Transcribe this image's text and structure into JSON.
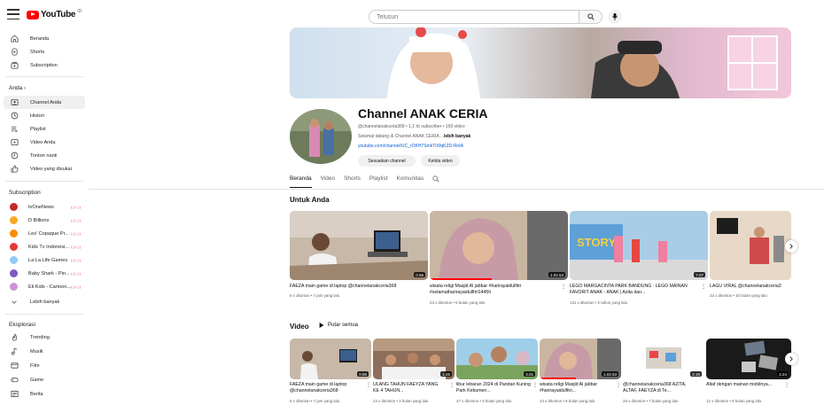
{
  "header": {
    "logo_text": "YouTube",
    "logo_sup": "ID",
    "search_placeholder": "Telusuri"
  },
  "sidebar": {
    "main": [
      {
        "label": "Beranda",
        "icon": "home-icon"
      },
      {
        "label": "Shorts",
        "icon": "shorts-icon"
      },
      {
        "label": "Subscription",
        "icon": "subscriptions-icon"
      }
    ],
    "you_heading": "Anda",
    "you": [
      {
        "label": "Channel Anda",
        "icon": "channel-icon",
        "active": true
      },
      {
        "label": "Histori",
        "icon": "history-icon"
      },
      {
        "label": "Playlist",
        "icon": "playlist-icon"
      },
      {
        "label": "Video Anda",
        "icon": "your-videos-icon"
      },
      {
        "label": "Tonton nanti",
        "icon": "watch-later-icon"
      },
      {
        "label": "Video yang disukai",
        "icon": "liked-icon"
      }
    ],
    "subs_heading": "Subscription",
    "subs": [
      {
        "label": "tvOneNews",
        "color": "#c62828"
      },
      {
        "label": "D Billions",
        "color": "#f9a825"
      },
      {
        "label": "Les' Copaque Pr...",
        "color": "#fb8c00"
      },
      {
        "label": "Kids Tv Indonesi...",
        "color": "#e53935"
      },
      {
        "label": "La La Life Games",
        "color": "#90caf9"
      },
      {
        "label": "Baby Shark - Pin...",
        "color": "#7e57c2"
      },
      {
        "label": "Eli Kids - Cartoon...",
        "color": "#ce93d8"
      }
    ],
    "more_label": "Lebih banyak",
    "explore_heading": "Eksplorasi",
    "explore": [
      {
        "label": "Trending",
        "icon": "trending-icon"
      },
      {
        "label": "Musik",
        "icon": "music-icon"
      },
      {
        "label": "Film",
        "icon": "film-icon"
      },
      {
        "label": "Game",
        "icon": "game-icon"
      },
      {
        "label": "Berita",
        "icon": "news-icon"
      }
    ]
  },
  "channel": {
    "name": "Channel ANAK CERIA",
    "meta": "@channelanakceria368 • 1,1 rb subscriber • 160 video",
    "desc_prefix": "Selamat datang di Channel ANAK CERIA ...",
    "desc_more": "lebih banyak",
    "link": "youtube.com/channel/UC_rOKH7SmkTtXfqKZD-RoIA",
    "customize_label": "Sesuaikan channel",
    "manage_label": "Kelola video"
  },
  "tabs": [
    "Beranda",
    "Video",
    "Shorts",
    "Playlist",
    "Komunitas"
  ],
  "sections": {
    "for_you": "Untuk Anda",
    "videos": "Video",
    "play_all": "Putar semua"
  },
  "for_you_videos": [
    {
      "title": "FAEZA main game di laptop @channelanakceria368",
      "meta": "5 x ditonton • 7 jam yang lalu",
      "duration": "0.56"
    },
    {
      "title": "wisata religi Masjid Al jabbar #harirayaidulfitri #selamatharirayaidulfitri1445h",
      "meta": "23 x ditonton • 6 bulan yang lalu",
      "duration": "1.02.53"
    },
    {
      "title": "LEGO MARGACINTA PARK BANDUNG : LEGO MAINAN FAVORIT ANAK - ANAK | Azita dan...",
      "meta": "131 x ditonton • 2 tahun yang lalu",
      "duration": "7.07"
    },
    {
      "title": "LAGU VIRAL @channelanakceria3",
      "meta": "23 x ditonton • 10 bulan yang lalu",
      "duration": ""
    }
  ],
  "videos": [
    {
      "title": "FAEZA main game di laptop @channelanakceria368",
      "meta": "5 x ditonton • 7 jam yang lalu",
      "duration": "0.56"
    },
    {
      "title": "ULANG TAHUN FAEYZA YANG KE 4 TAHUN...",
      "meta": "24 x ditonton • 3 bulan yang lalu",
      "duration": "1.26"
    },
    {
      "title": "libur lebaran 2024 di Pandan Kuning Park Kebumen...",
      "meta": "47 x ditonton • 3 bulan yang lalu",
      "duration": "4.01"
    },
    {
      "title": "wisata religi Masjid Al jabbar #harirayaidulfitri...",
      "meta": "23 x ditonton • 6 bulan yang lalu",
      "duration": "1.02.53"
    },
    {
      "title": "@channelanakceria368 AZITA, ALTAF, FAEYZA di Te...",
      "meta": "26 x ditonton • 7 bulan yang lalu",
      "duration": "2.18"
    },
    {
      "title": "Altaf dengan mainan mobilnya...",
      "meta": "12 x ditonton • 8 bulan yang lalu",
      "duration": "2.24"
    }
  ]
}
